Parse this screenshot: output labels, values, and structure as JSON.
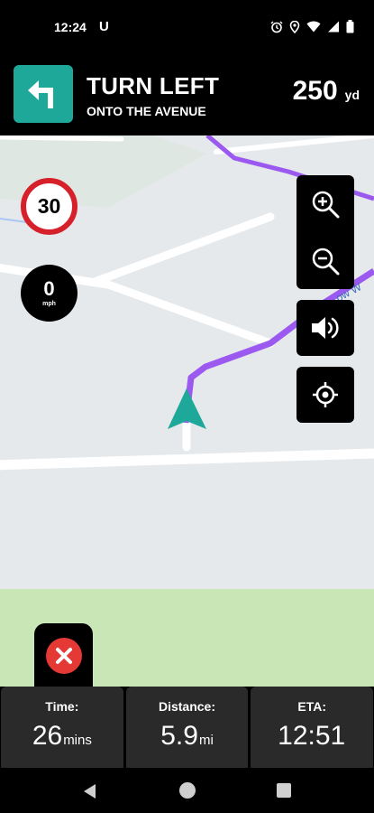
{
  "status_bar": {
    "time": "12:24",
    "app_icon_letter": "U",
    "icons": [
      "alarm-icon",
      "location-icon",
      "wifi-icon",
      "signal-icon",
      "battery-icon"
    ]
  },
  "instruction": {
    "maneuver_icon": "turn-left-arrow-icon",
    "title": "TURN LEFT",
    "subtitle": "ONTO THE AVENUE",
    "distance_value": "250",
    "distance_unit": "yd",
    "accent_color": "#1ea89a"
  },
  "map": {
    "road_label": "ow W",
    "route_color": "#9b59f0",
    "position_marker_color": "#1ea89a"
  },
  "speed_limit": {
    "value": "30",
    "ring_color": "#d6212b"
  },
  "current_speed": {
    "value": "0",
    "unit": "mph"
  },
  "controls": {
    "zoom_in_icon": "zoom-in-icon",
    "zoom_out_icon": "zoom-out-icon",
    "sound_icon": "volume-icon",
    "recenter_icon": "crosshair-icon"
  },
  "cancel_button": {
    "icon": "close-icon",
    "color": "#e53935"
  },
  "trip_stats": [
    {
      "label": "Time:",
      "value": "26",
      "unit": "mins"
    },
    {
      "label": "Distance:",
      "value": "5.9",
      "unit": "mi"
    },
    {
      "label": "ETA:",
      "value": "12:51",
      "unit": ""
    }
  ],
  "system_nav": [
    "back-icon",
    "home-icon",
    "recents-icon"
  ]
}
